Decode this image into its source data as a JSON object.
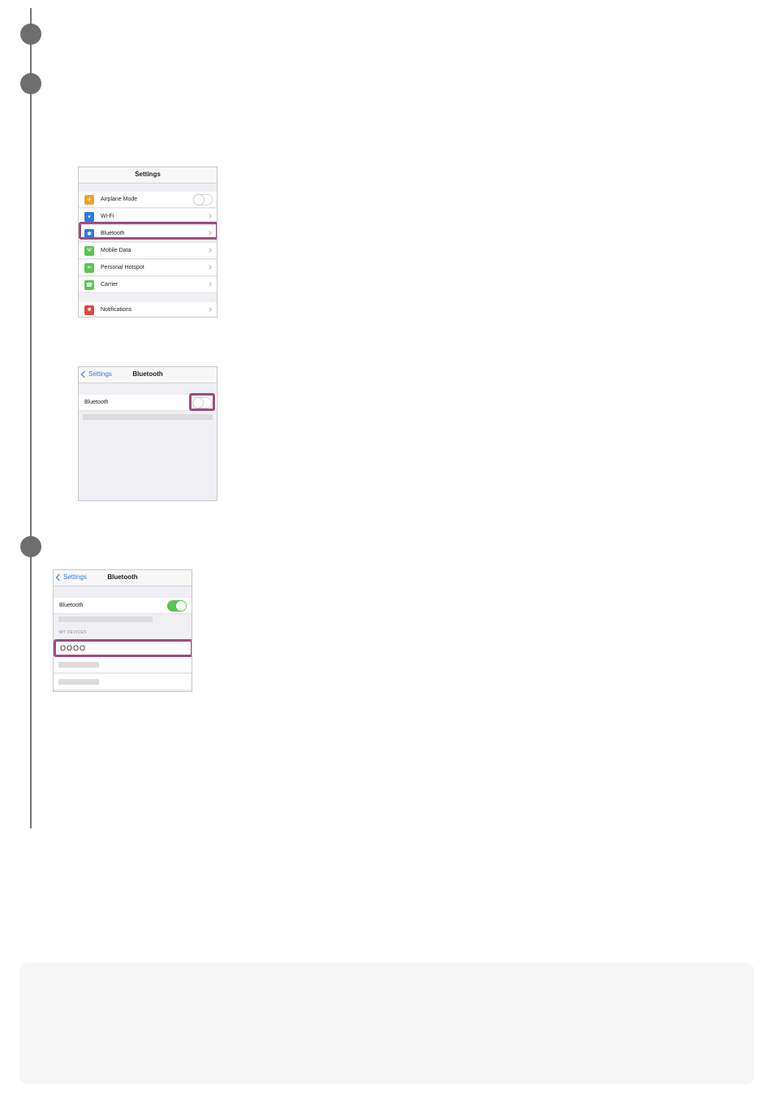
{
  "screen1": {
    "title": "Settings",
    "rows": [
      {
        "label": "Airplane Mode",
        "icon": "airplane-icon",
        "color": "#f0a030"
      },
      {
        "label": "Wi-Fi",
        "icon": "wifi-icon",
        "color": "#2a7bd9"
      },
      {
        "label": "Bluetooth",
        "icon": "bluetooth-icon",
        "color": "#2a7bd9"
      },
      {
        "label": "Mobile Data",
        "icon": "antenna-icon",
        "color": "#5cc453"
      },
      {
        "label": "Personal Hotspot",
        "icon": "hotspot-icon",
        "color": "#5cc453"
      },
      {
        "label": "Carrier",
        "icon": "phone-icon",
        "color": "#5cc453"
      },
      {
        "label": "Notifications",
        "icon": "notifications-icon",
        "color": "#e0463c"
      }
    ]
  },
  "screen2": {
    "back": "Settings",
    "title": "Bluetooth",
    "toggle_label": "Bluetooth"
  },
  "screen3": {
    "back": "Settings",
    "title": "Bluetooth",
    "toggle_label": "Bluetooth",
    "section": "MY DEVICES",
    "device": "OOOO"
  },
  "colors": {
    "highlight": "#9e4d7e",
    "toggle_on": "#5cc453",
    "link": "#2a7bd9"
  }
}
